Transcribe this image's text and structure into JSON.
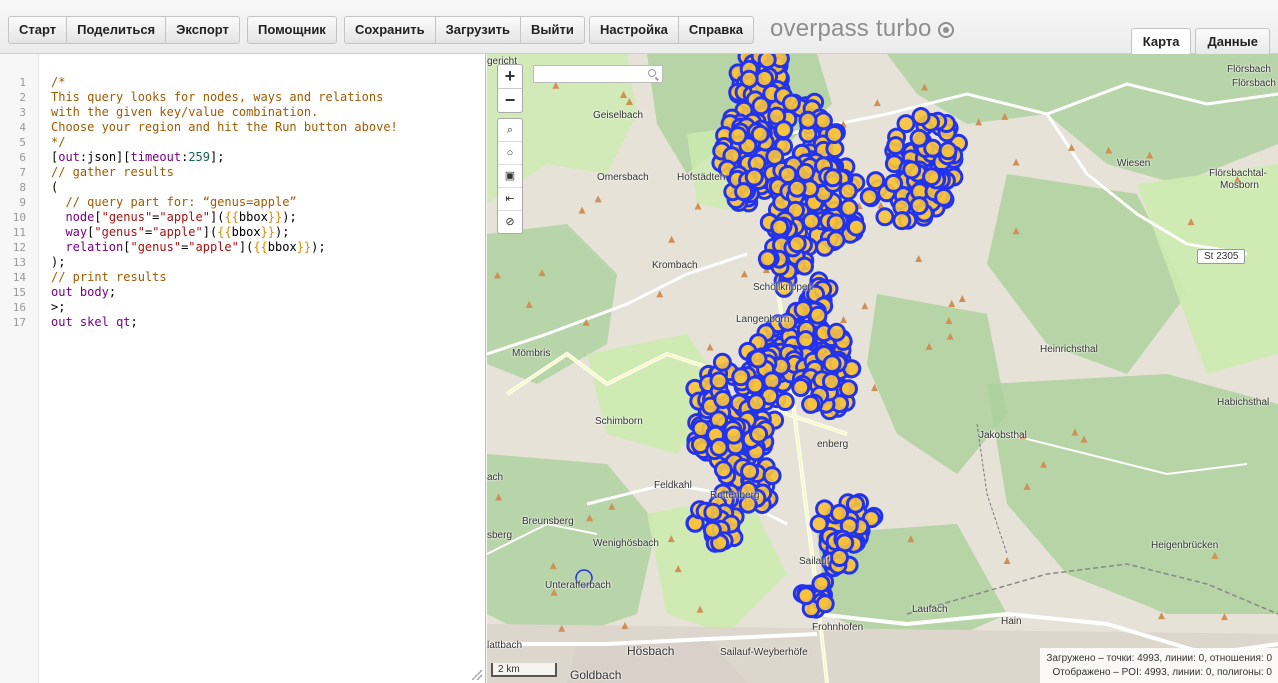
{
  "toolbar": {
    "group1": [
      "Старт",
      "Поделиться",
      "Экспорт"
    ],
    "group2": [
      "Помощник"
    ],
    "group3": [
      "Сохранить",
      "Загрузить",
      "Выйти"
    ],
    "group4": [
      "Настройка",
      "Справка"
    ]
  },
  "logo": "overpass turbo",
  "tabs": {
    "map": "Карта",
    "data": "Данные",
    "active": "map"
  },
  "editor": {
    "line_numbers": [
      "1",
      "2",
      "3",
      "4",
      "5",
      "6",
      "7",
      "8",
      "9",
      "10",
      "11",
      "12",
      "13",
      "14",
      "15",
      "16",
      "17"
    ]
  },
  "map": {
    "zoom_in": "+",
    "zoom_out": "−",
    "places": {
      "gericht": "gericht",
      "florsbach1": "Flörsbach",
      "florsbach2": "Flörsbach",
      "geiselbach": "Geiselbach",
      "omersbach": "Omersbach",
      "hofstadten": "Hofstädten",
      "wiesen": "Wiesen",
      "florsbachtal": "Flörsbachtal-",
      "mosborn": "Mosborn",
      "krombach": "Krombach",
      "schollkrippen": "Schöllkrippen",
      "langenborn": "Langenborn",
      "mombris": "Mömbris",
      "heinrichsthal": "Heinrichsthal",
      "habichsthal": "Habichsthal",
      "schimborn": "Schimborn",
      "jakobsthal": "Jakobsthal",
      "enberg": "enberg",
      "feldkahl": "Feldkahl",
      "rottenberg": "Rottenberg",
      "ach": "ach",
      "breunsberg": "Breunsberg",
      "sberg": "sberg",
      "wenighosbach": "Wenighösbach",
      "heigenbrucken": "Heigenbrücken",
      "sailauf": "Sailauf",
      "unterafferbach": "Unterafferbach",
      "laufach": "Laufach",
      "frohnhofen": "Frohnhofen",
      "hain": "Hain",
      "hattbach": "lattbach",
      "hosbach": "Hösbach",
      "sailauf_weyberhofe": "Sailauf-Weyberhöfe",
      "goldbach": "Goldbach",
      "shield": "St 2305"
    },
    "scale": "2 km",
    "stats_loaded": "Загружено – точки: 4993, линии: 0, отношения: 0",
    "stats_shown": "Отображено – POI: 4993, линии: 0, полигоны: 0"
  },
  "colors": {
    "marker_fill": "#f8c33a",
    "marker_stroke": "#2233ee",
    "forest": "#add19e",
    "meadow": "#cdebb0",
    "road": "#ffffff",
    "peak": "#d08f55"
  }
}
